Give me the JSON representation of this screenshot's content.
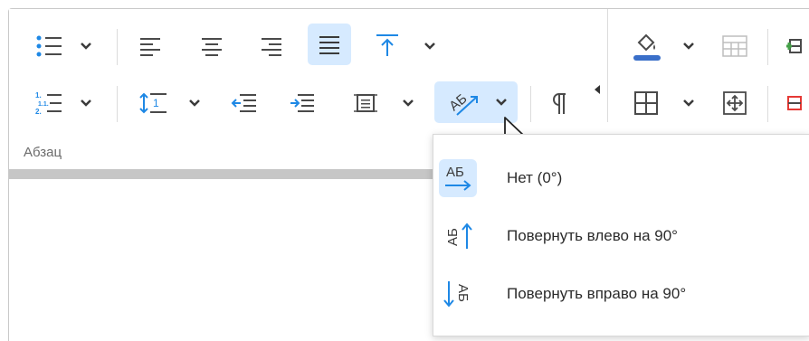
{
  "paragraph_group": {
    "label": "Абзац",
    "text_direction_menu": {
      "items": [
        {
          "label": "Нет (0°)",
          "icon": "text-direction-none-icon",
          "selected": true
        },
        {
          "label": "Повернуть влево на 90°",
          "icon": "text-rotate-left-icon",
          "selected": false
        },
        {
          "label": "Повернуть вправо на 90°",
          "icon": "text-rotate-right-icon",
          "selected": false
        }
      ]
    },
    "icon_glyph_text": "АБ"
  },
  "colors": {
    "accent": "#1e88e5",
    "active_bg": "#d6eaff",
    "icon_gray": "#4a4a4a",
    "fill_color_bar": "#3a6fc9",
    "red_icon": "#e53935",
    "green_icon": "#43a047"
  },
  "toolbar_icons": [
    "bulleted-list-icon",
    "numbered-list-icon",
    "align-left-icon",
    "align-center-icon",
    "align-right-icon",
    "justify-icon",
    "vertical-align-top-icon",
    "line-spacing-icon",
    "decrease-indent-icon",
    "increase-indent-icon",
    "cell-margins-icon",
    "text-direction-icon",
    "pilcrow-icon",
    "fill-color-icon",
    "table-grid-icon",
    "borders-icon",
    "move-table-icon"
  ]
}
